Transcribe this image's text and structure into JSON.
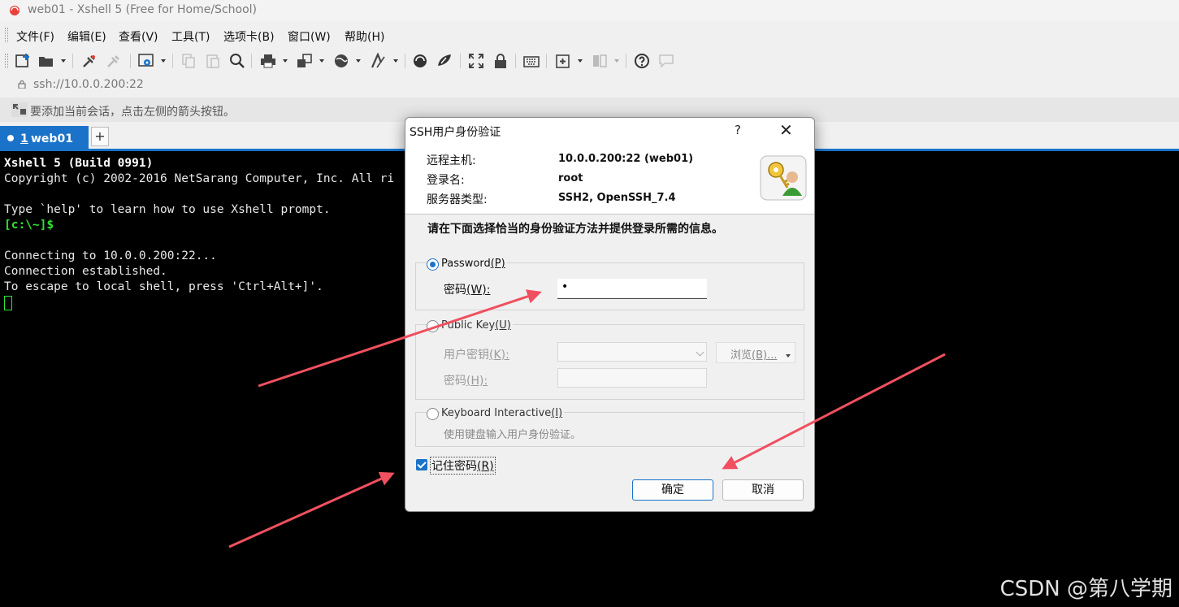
{
  "window": {
    "title": "web01 - Xshell 5 (Free for Home/School)"
  },
  "menu": [
    "文件(F)",
    "编辑(E)",
    "查看(V)",
    "工具(T)",
    "选项卡(B)",
    "窗口(W)",
    "帮助(H)"
  ],
  "address": {
    "url": "ssh://10.0.0.200:22"
  },
  "hint": {
    "text": "要添加当前会话，点击左侧的箭头按钮。"
  },
  "tab": {
    "number": "1",
    "name": "web01",
    "add_label": "+"
  },
  "terminal": {
    "lines": [
      "Xshell 5 (Build 0991)",
      "Copyright (c) 2002-2016 NetSarang Computer, Inc. All ri",
      "",
      "Type `help' to learn how to use Xshell prompt.",
      "[c:\\~]$",
      "",
      "Connecting to 10.0.0.200:22...",
      "Connection established.",
      "To escape to local shell, press 'Ctrl+Alt+]'."
    ]
  },
  "dialog": {
    "title": "SSH用户身份验证",
    "help": "?",
    "close": "✕",
    "info": {
      "host_label": "远程主机:",
      "host_value": "10.0.0.200:22 (web01)",
      "login_label": "登录名:",
      "login_value": "root",
      "server_label": "服务器类型:",
      "server_value": "SSH2, OpenSSH_7.4"
    },
    "instruction": "请在下面选择恰当的身份验证方法并提供登录所需的信息。",
    "password": {
      "label": "Password",
      "hotkey": "(P)",
      "field_label": "密码",
      "field_hotkey": "(W):",
      "value": "•"
    },
    "publickey": {
      "label": "Public Key",
      "hotkey": "(U)",
      "userkey_label": "用户密钥",
      "userkey_hotkey": "(K):",
      "pass_label": "密码",
      "pass_hotkey": "(H):",
      "browse_label": "浏览",
      "browse_hotkey": "(B)..."
    },
    "keyboard": {
      "label": "Keyboard Interactive",
      "hotkey": "(I)",
      "description": "使用键盘输入用户身份验证。"
    },
    "remember": {
      "label": "记住密码",
      "hotkey": "(R)",
      "checked": true
    },
    "ok_label": "确定",
    "cancel_label": "取消"
  },
  "watermark": "CSDN @第八学期",
  "colors": {
    "accent": "#1a73c9",
    "arrow": "#f0505f",
    "terminal_bg": "#000000",
    "prompt": "#2ee62e"
  }
}
